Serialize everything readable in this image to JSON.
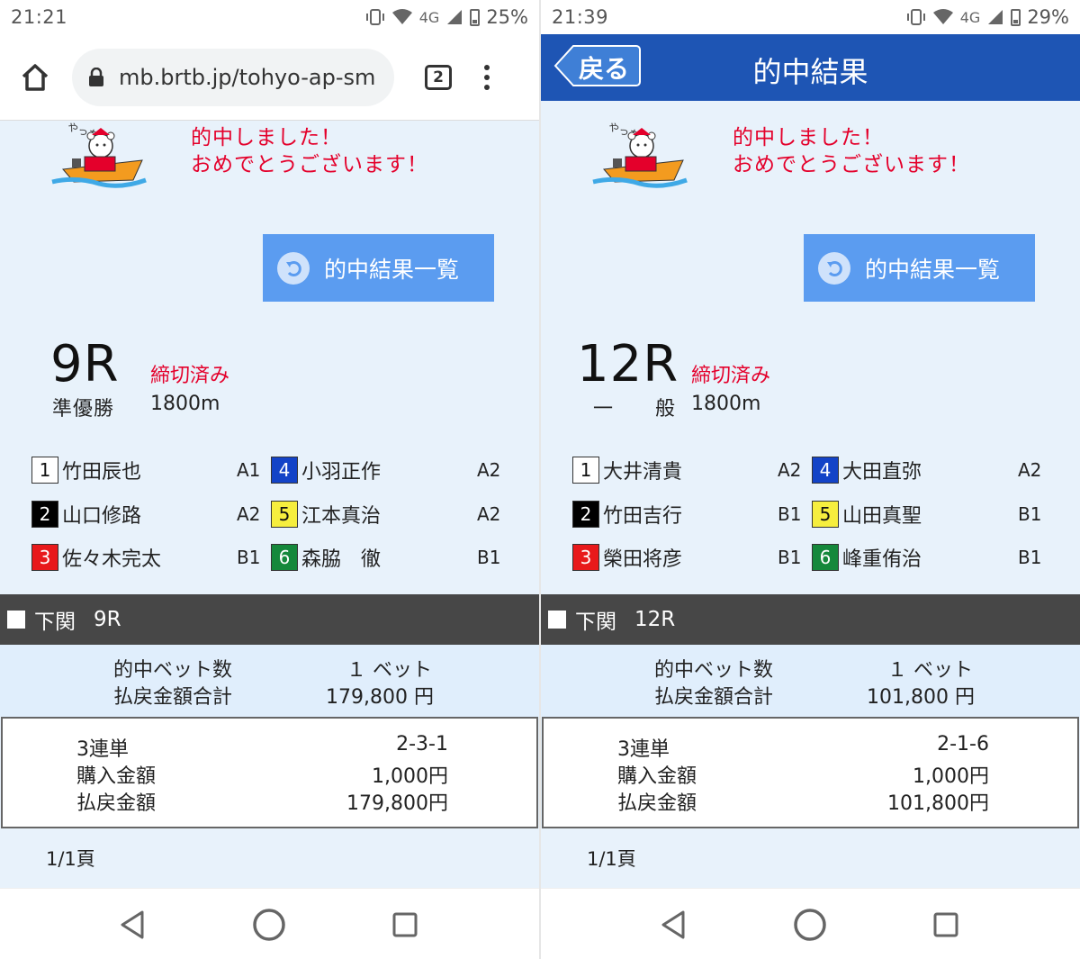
{
  "left": {
    "status": {
      "time": "21:21",
      "network": "4G",
      "battery": "25%"
    },
    "browser": {
      "url": "mb.brtb.jp/tohyo-ap-sm",
      "tab_count": "2"
    },
    "congrats": {
      "line1": "的中しました！",
      "line2": "おめでとうございます！"
    },
    "list_button": "的中結果一覧",
    "race": {
      "number": "9R",
      "closed": "締切済み",
      "grade": "準優勝",
      "distance": "1800m"
    },
    "racers": [
      {
        "waku": "1",
        "name": "竹田辰也",
        "rank": "A1"
      },
      {
        "waku": "2",
        "name": "山口修路",
        "rank": "A2"
      },
      {
        "waku": "3",
        "name": "佐々木完太",
        "rank": "B1"
      },
      {
        "waku": "4",
        "name": "小羽正作",
        "rank": "A2"
      },
      {
        "waku": "5",
        "name": "江本真治",
        "rank": "A2"
      },
      {
        "waku": "6",
        "name": "森脇　徹",
        "rank": "B1"
      }
    ],
    "venue": {
      "name": "下関",
      "race": "9R"
    },
    "summary": {
      "bets_label": "的中ベット数",
      "bets_value": "１ ベット",
      "total_label": "払戻金額合計",
      "total_value": "179,800 円"
    },
    "detail": {
      "type_label": "3連単",
      "type_value": "2-3-1",
      "purchase_label": "購入金額",
      "purchase_value": "1,000円",
      "payout_label": "払戻金額",
      "payout_value": "179,800円"
    },
    "page": "1/1頁"
  },
  "right": {
    "status": {
      "time": "21:39",
      "network": "4G",
      "battery": "29%"
    },
    "header": {
      "back_label": "戻る",
      "title": "的中結果"
    },
    "congrats": {
      "line1": "的中しました！",
      "line2": "おめでとうございます！"
    },
    "list_button": "的中結果一覧",
    "race": {
      "number": "12R",
      "closed": "締切済み",
      "grade": "一　　般",
      "distance": "1800m"
    },
    "racers": [
      {
        "waku": "1",
        "name": "大井清貴",
        "rank": "A2"
      },
      {
        "waku": "2",
        "name": "竹田吉行",
        "rank": "B1"
      },
      {
        "waku": "3",
        "name": "榮田将彦",
        "rank": "B1"
      },
      {
        "waku": "4",
        "name": "大田直弥",
        "rank": "A2"
      },
      {
        "waku": "5",
        "name": "山田真聖",
        "rank": "B1"
      },
      {
        "waku": "6",
        "name": "峰重侑治",
        "rank": "B1"
      }
    ],
    "venue": {
      "name": "下関",
      "race": "12R"
    },
    "summary": {
      "bets_label": "的中ベット数",
      "bets_value": "１ ベット",
      "total_label": "払戻金額合計",
      "total_value": "101,800 円"
    },
    "detail": {
      "type_label": "3連単",
      "type_value": "2-1-6",
      "purchase_label": "購入金額",
      "purchase_value": "1,000円",
      "payout_label": "払戻金額",
      "payout_value": "101,800円"
    },
    "page": "1/1頁"
  },
  "colors": {
    "header_blue": "#1e55b4",
    "button_blue": "#5b9cf0",
    "content_bg": "#e8f2fb",
    "alert_red": "#e4002b",
    "venue_bar": "#474747",
    "waku": [
      "#ffffff",
      "#000000",
      "#e8191b",
      "#1343c7",
      "#f6ee3e",
      "#15883b"
    ]
  },
  "icons": [
    "home-icon",
    "lock-icon",
    "tabs-icon",
    "menu-icon",
    "back-arrow-icon",
    "return-icon",
    "mascot-bear-boat",
    "nav-back-icon",
    "nav-home-icon",
    "nav-recents-icon"
  ]
}
